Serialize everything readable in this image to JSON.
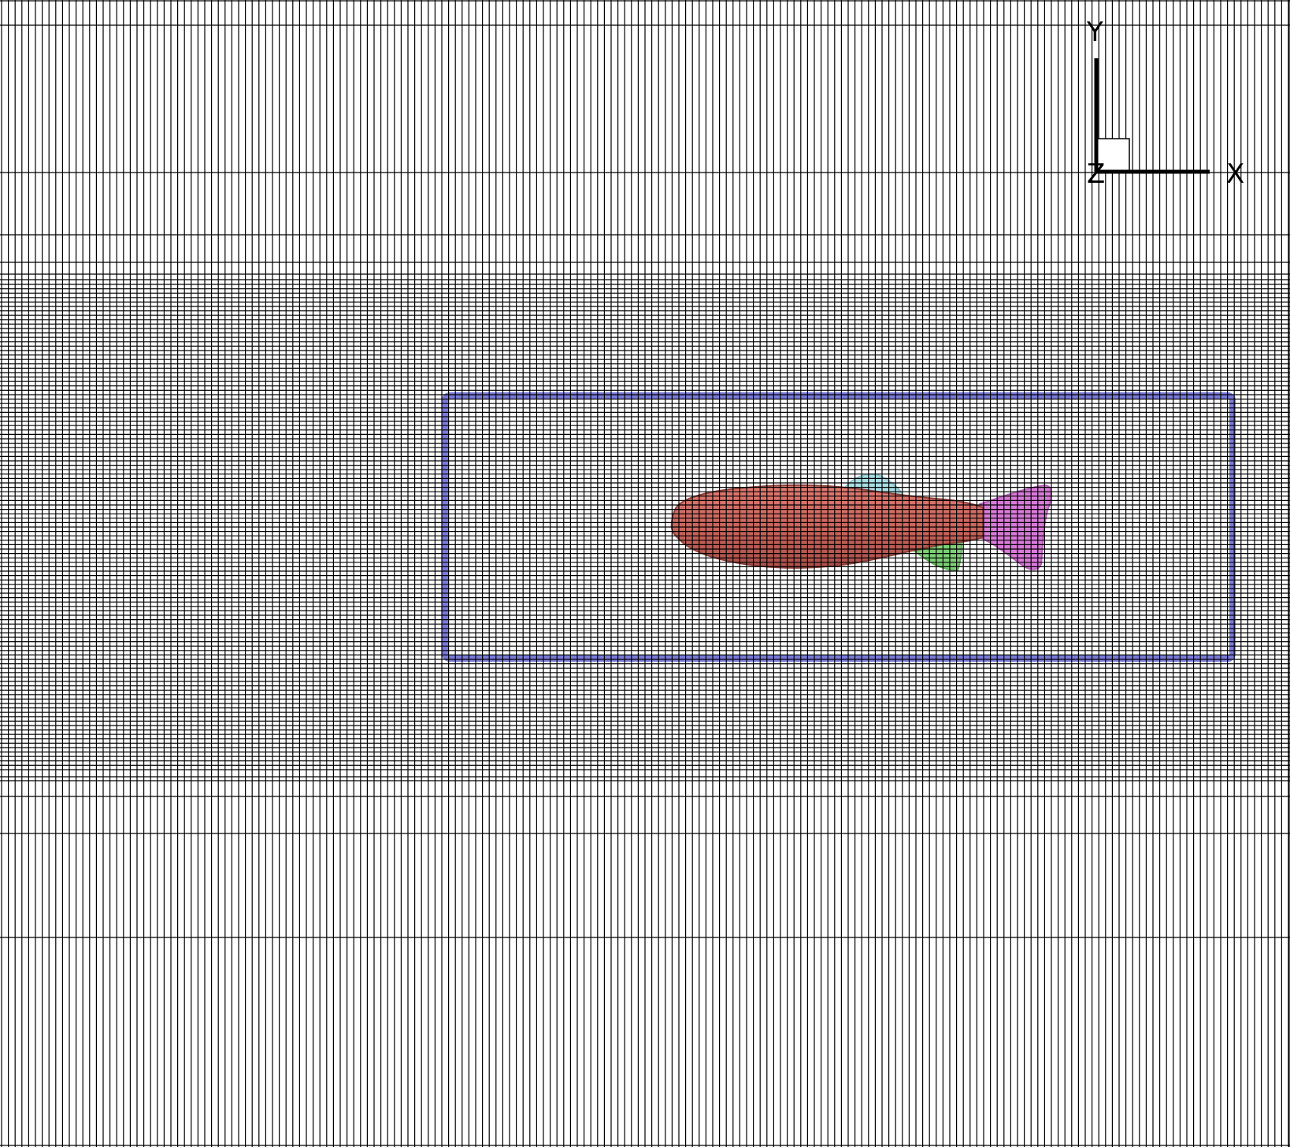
{
  "axes": {
    "x_label": "X",
    "y_label": "Y",
    "z_label": "Z"
  },
  "colors": {
    "background": "#ffffff",
    "grid_line": "#000000",
    "refinement_box": "#6b6bd6",
    "fish_body": "#c96b63",
    "dorsal_fin": "#a8dfe6",
    "anal_fin": "#7ccf75",
    "caudal_fin": "#d97ad9",
    "triad": "#000000"
  },
  "scene": {
    "type": "computational mesh with immersed fish body",
    "fish_parts": [
      "body",
      "dorsal-fin",
      "anal-fin",
      "caudal-fin"
    ]
  }
}
